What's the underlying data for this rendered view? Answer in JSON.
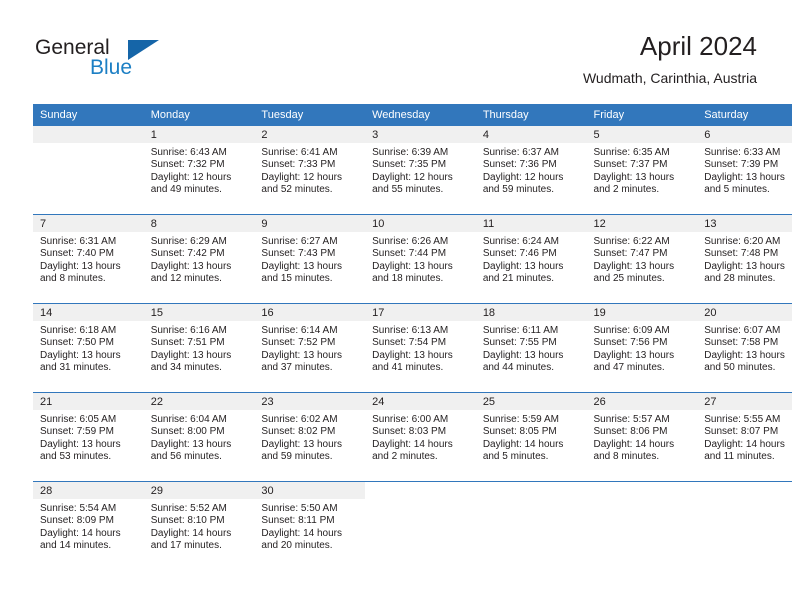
{
  "brand": {
    "name_part1": "General",
    "name_part2": "Blue",
    "triangle_color": "#1565a8",
    "blue_color": "#1c7fc4"
  },
  "header": {
    "title": "April 2024",
    "location": "Wudmath, Carinthia, Austria",
    "accent_color": "#3277bc",
    "band_color": "#f0f0f0"
  },
  "weekdays": [
    "Sunday",
    "Monday",
    "Tuesday",
    "Wednesday",
    "Thursday",
    "Friday",
    "Saturday"
  ],
  "labels": {
    "sunrise": "Sunrise:",
    "sunset": "Sunset:",
    "daylight": "Daylight:"
  },
  "weeks": [
    [
      {
        "day": "",
        "empty": true
      },
      {
        "day": "1",
        "sunrise": "Sunrise: 6:43 AM",
        "sunset": "Sunset: 7:32 PM",
        "daylight1": "Daylight: 12 hours",
        "daylight2": "and 49 minutes."
      },
      {
        "day": "2",
        "sunrise": "Sunrise: 6:41 AM",
        "sunset": "Sunset: 7:33 PM",
        "daylight1": "Daylight: 12 hours",
        "daylight2": "and 52 minutes."
      },
      {
        "day": "3",
        "sunrise": "Sunrise: 6:39 AM",
        "sunset": "Sunset: 7:35 PM",
        "daylight1": "Daylight: 12 hours",
        "daylight2": "and 55 minutes."
      },
      {
        "day": "4",
        "sunrise": "Sunrise: 6:37 AM",
        "sunset": "Sunset: 7:36 PM",
        "daylight1": "Daylight: 12 hours",
        "daylight2": "and 59 minutes."
      },
      {
        "day": "5",
        "sunrise": "Sunrise: 6:35 AM",
        "sunset": "Sunset: 7:37 PM",
        "daylight1": "Daylight: 13 hours",
        "daylight2": "and 2 minutes."
      },
      {
        "day": "6",
        "sunrise": "Sunrise: 6:33 AM",
        "sunset": "Sunset: 7:39 PM",
        "daylight1": "Daylight: 13 hours",
        "daylight2": "and 5 minutes."
      }
    ],
    [
      {
        "day": "7",
        "sunrise": "Sunrise: 6:31 AM",
        "sunset": "Sunset: 7:40 PM",
        "daylight1": "Daylight: 13 hours",
        "daylight2": "and 8 minutes."
      },
      {
        "day": "8",
        "sunrise": "Sunrise: 6:29 AM",
        "sunset": "Sunset: 7:42 PM",
        "daylight1": "Daylight: 13 hours",
        "daylight2": "and 12 minutes."
      },
      {
        "day": "9",
        "sunrise": "Sunrise: 6:27 AM",
        "sunset": "Sunset: 7:43 PM",
        "daylight1": "Daylight: 13 hours",
        "daylight2": "and 15 minutes."
      },
      {
        "day": "10",
        "sunrise": "Sunrise: 6:26 AM",
        "sunset": "Sunset: 7:44 PM",
        "daylight1": "Daylight: 13 hours",
        "daylight2": "and 18 minutes."
      },
      {
        "day": "11",
        "sunrise": "Sunrise: 6:24 AM",
        "sunset": "Sunset: 7:46 PM",
        "daylight1": "Daylight: 13 hours",
        "daylight2": "and 21 minutes."
      },
      {
        "day": "12",
        "sunrise": "Sunrise: 6:22 AM",
        "sunset": "Sunset: 7:47 PM",
        "daylight1": "Daylight: 13 hours",
        "daylight2": "and 25 minutes."
      },
      {
        "day": "13",
        "sunrise": "Sunrise: 6:20 AM",
        "sunset": "Sunset: 7:48 PM",
        "daylight1": "Daylight: 13 hours",
        "daylight2": "and 28 minutes."
      }
    ],
    [
      {
        "day": "14",
        "sunrise": "Sunrise: 6:18 AM",
        "sunset": "Sunset: 7:50 PM",
        "daylight1": "Daylight: 13 hours",
        "daylight2": "and 31 minutes."
      },
      {
        "day": "15",
        "sunrise": "Sunrise: 6:16 AM",
        "sunset": "Sunset: 7:51 PM",
        "daylight1": "Daylight: 13 hours",
        "daylight2": "and 34 minutes."
      },
      {
        "day": "16",
        "sunrise": "Sunrise: 6:14 AM",
        "sunset": "Sunset: 7:52 PM",
        "daylight1": "Daylight: 13 hours",
        "daylight2": "and 37 minutes."
      },
      {
        "day": "17",
        "sunrise": "Sunrise: 6:13 AM",
        "sunset": "Sunset: 7:54 PM",
        "daylight1": "Daylight: 13 hours",
        "daylight2": "and 41 minutes."
      },
      {
        "day": "18",
        "sunrise": "Sunrise: 6:11 AM",
        "sunset": "Sunset: 7:55 PM",
        "daylight1": "Daylight: 13 hours",
        "daylight2": "and 44 minutes."
      },
      {
        "day": "19",
        "sunrise": "Sunrise: 6:09 AM",
        "sunset": "Sunset: 7:56 PM",
        "daylight1": "Daylight: 13 hours",
        "daylight2": "and 47 minutes."
      },
      {
        "day": "20",
        "sunrise": "Sunrise: 6:07 AM",
        "sunset": "Sunset: 7:58 PM",
        "daylight1": "Daylight: 13 hours",
        "daylight2": "and 50 minutes."
      }
    ],
    [
      {
        "day": "21",
        "sunrise": "Sunrise: 6:05 AM",
        "sunset": "Sunset: 7:59 PM",
        "daylight1": "Daylight: 13 hours",
        "daylight2": "and 53 minutes."
      },
      {
        "day": "22",
        "sunrise": "Sunrise: 6:04 AM",
        "sunset": "Sunset: 8:00 PM",
        "daylight1": "Daylight: 13 hours",
        "daylight2": "and 56 minutes."
      },
      {
        "day": "23",
        "sunrise": "Sunrise: 6:02 AM",
        "sunset": "Sunset: 8:02 PM",
        "daylight1": "Daylight: 13 hours",
        "daylight2": "and 59 minutes."
      },
      {
        "day": "24",
        "sunrise": "Sunrise: 6:00 AM",
        "sunset": "Sunset: 8:03 PM",
        "daylight1": "Daylight: 14 hours",
        "daylight2": "and 2 minutes."
      },
      {
        "day": "25",
        "sunrise": "Sunrise: 5:59 AM",
        "sunset": "Sunset: 8:05 PM",
        "daylight1": "Daylight: 14 hours",
        "daylight2": "and 5 minutes."
      },
      {
        "day": "26",
        "sunrise": "Sunrise: 5:57 AM",
        "sunset": "Sunset: 8:06 PM",
        "daylight1": "Daylight: 14 hours",
        "daylight2": "and 8 minutes."
      },
      {
        "day": "27",
        "sunrise": "Sunrise: 5:55 AM",
        "sunset": "Sunset: 8:07 PM",
        "daylight1": "Daylight: 14 hours",
        "daylight2": "and 11 minutes."
      }
    ],
    [
      {
        "day": "28",
        "sunrise": "Sunrise: 5:54 AM",
        "sunset": "Sunset: 8:09 PM",
        "daylight1": "Daylight: 14 hours",
        "daylight2": "and 14 minutes."
      },
      {
        "day": "29",
        "sunrise": "Sunrise: 5:52 AM",
        "sunset": "Sunset: 8:10 PM",
        "daylight1": "Daylight: 14 hours",
        "daylight2": "and 17 minutes."
      },
      {
        "day": "30",
        "sunrise": "Sunrise: 5:50 AM",
        "sunset": "Sunset: 8:11 PM",
        "daylight1": "Daylight: 14 hours",
        "daylight2": "and 20 minutes."
      },
      {
        "day": "",
        "empty": true,
        "blank": true
      },
      {
        "day": "",
        "empty": true,
        "blank": true
      },
      {
        "day": "",
        "empty": true,
        "blank": true
      },
      {
        "day": "",
        "empty": true,
        "blank": true
      }
    ]
  ]
}
